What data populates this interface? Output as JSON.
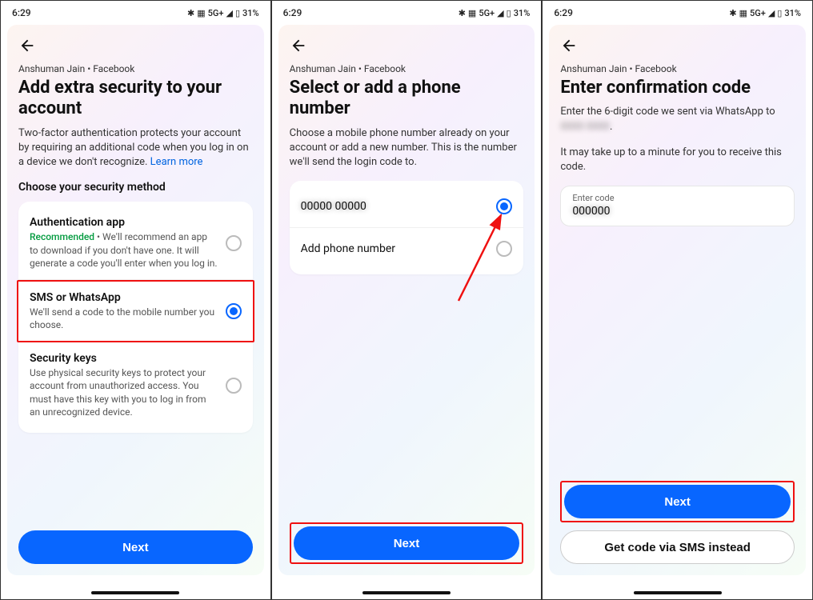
{
  "statusbar": {
    "time": "6:29",
    "network": "5G+",
    "battery": "31%"
  },
  "s1": {
    "breadcrumb": "Anshuman Jain • Facebook",
    "title": "Add extra security to your account",
    "desc": "Two-factor authentication protects your account by requiring an additional code when you log in on a device we don't recognize.",
    "learn_more": "Learn more",
    "section_label": "Choose your security method",
    "opt1": {
      "title": "Authentication app",
      "recommended": "Recommended",
      "sub": " • We'll recommend an app to download if you don't have one. It will generate a code you'll enter when you log in."
    },
    "opt2": {
      "title": "SMS or WhatsApp",
      "sub": "We'll send a code to the mobile number you choose."
    },
    "opt3": {
      "title": "Security keys",
      "sub": "Use physical security keys to protect your account from unauthorized access. You must have this key with you to log in from an unrecognized device."
    },
    "next": "Next"
  },
  "s2": {
    "breadcrumb": "Anshuman Jain • Facebook",
    "title": "Select or add a phone number",
    "desc": "Choose a mobile phone number already on your account or add a new number. This is the number we'll send the login code to.",
    "existing_number": "00000 00000",
    "add_phone": "Add phone number",
    "next": "Next"
  },
  "s3": {
    "breadcrumb": "Anshuman Jain • Facebook",
    "title": "Enter confirmation code",
    "desc1": "Enter the 6-digit code we sent via WhatsApp to",
    "redacted": "0000 0000",
    "desc2": "It may take up to a minute for you to receive this code.",
    "input_label": "Enter code",
    "input_value": "000000",
    "next": "Next",
    "sms_instead": "Get code via SMS instead"
  }
}
